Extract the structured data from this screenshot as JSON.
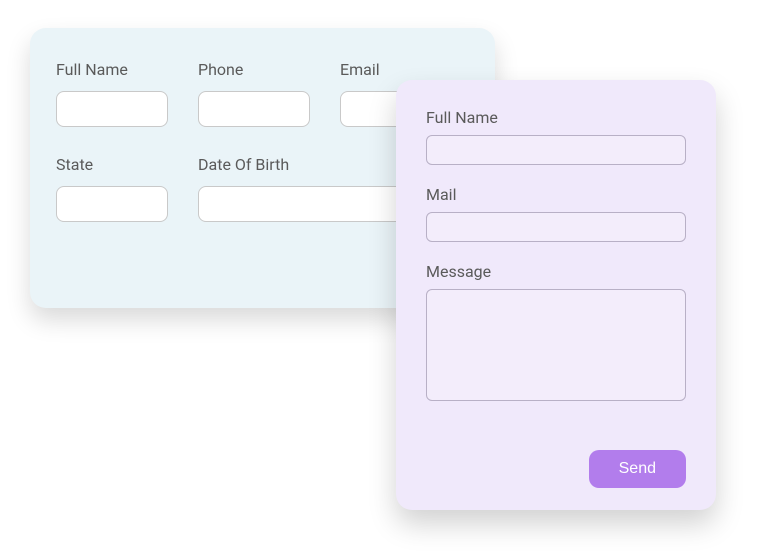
{
  "card_back": {
    "full_name": {
      "label": "Full Name",
      "value": ""
    },
    "phone": {
      "label": "Phone",
      "value": ""
    },
    "email": {
      "label": "Email",
      "value": ""
    },
    "state": {
      "label": "State",
      "value": ""
    },
    "dob": {
      "label": "Date Of Birth",
      "value": ""
    }
  },
  "card_front": {
    "full_name": {
      "label": "Full Name",
      "value": ""
    },
    "mail": {
      "label": "Mail",
      "value": ""
    },
    "message": {
      "label": "Message",
      "value": ""
    },
    "send_label": "Send"
  }
}
